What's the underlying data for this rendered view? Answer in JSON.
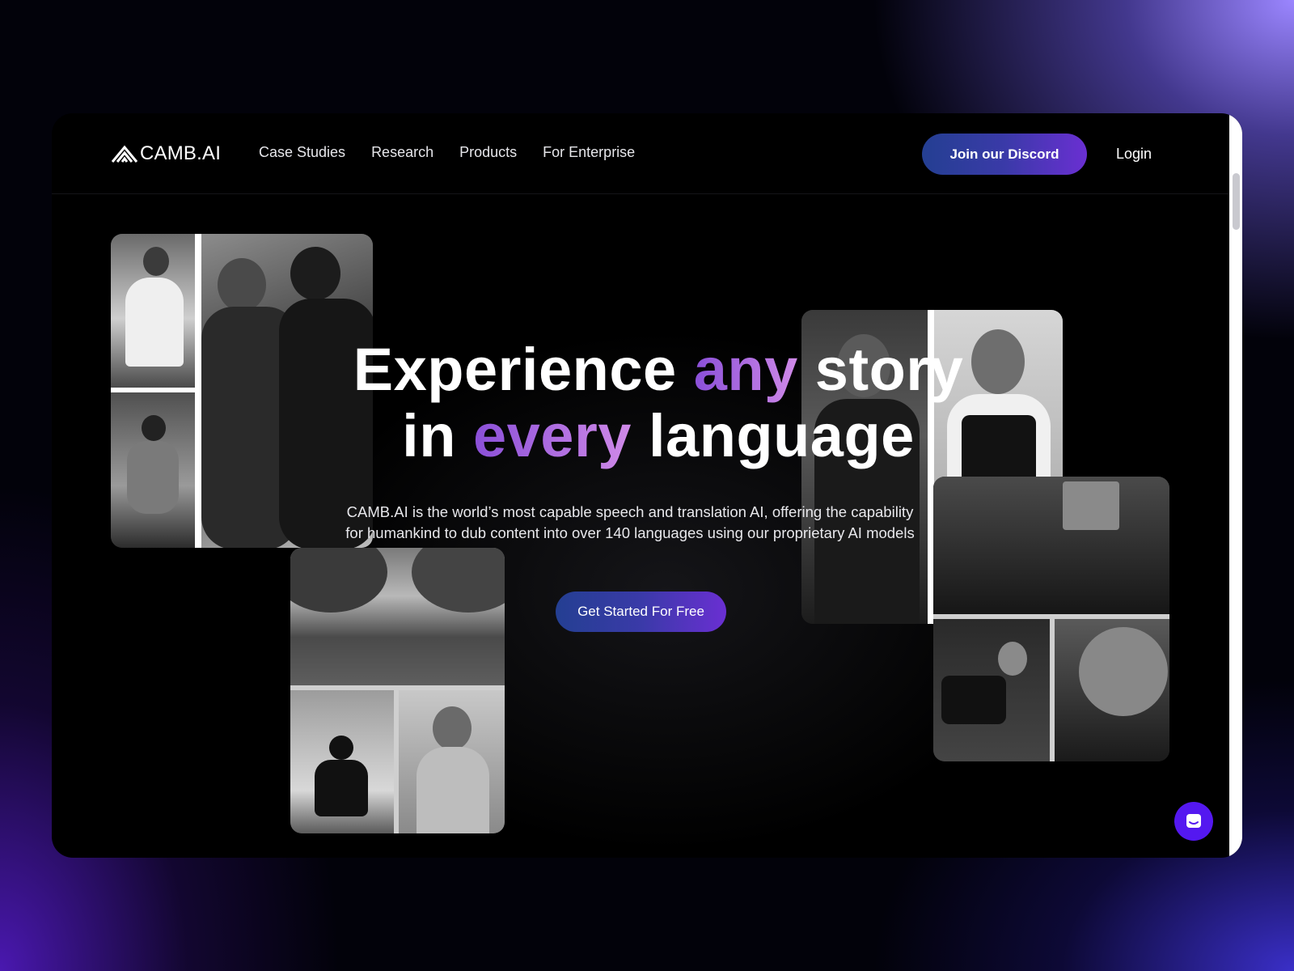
{
  "brand": {
    "name": "CAMB.AI"
  },
  "nav": {
    "links": [
      "Case Studies",
      "Research",
      "Products",
      "For Enterprise"
    ],
    "discord_label": "Join our Discord",
    "login_label": "Login"
  },
  "hero": {
    "line1_a": "Experience ",
    "line1_accent": "any",
    "line1_b": " story",
    "line2_a": "in ",
    "line2_accent": "every",
    "line2_b": " language",
    "subtitle": "CAMB.AI is the world’s most capable speech and translation AI, offering the capability for humankind to dub content into over 140 languages using our proprietary AI models",
    "cta_label": "Get Started For Free"
  },
  "colors": {
    "accent_purple": "#a46ae0",
    "button_gradient_start": "#243f92",
    "button_gradient_end": "#6a2fd2",
    "chat_button": "#5418f0"
  }
}
